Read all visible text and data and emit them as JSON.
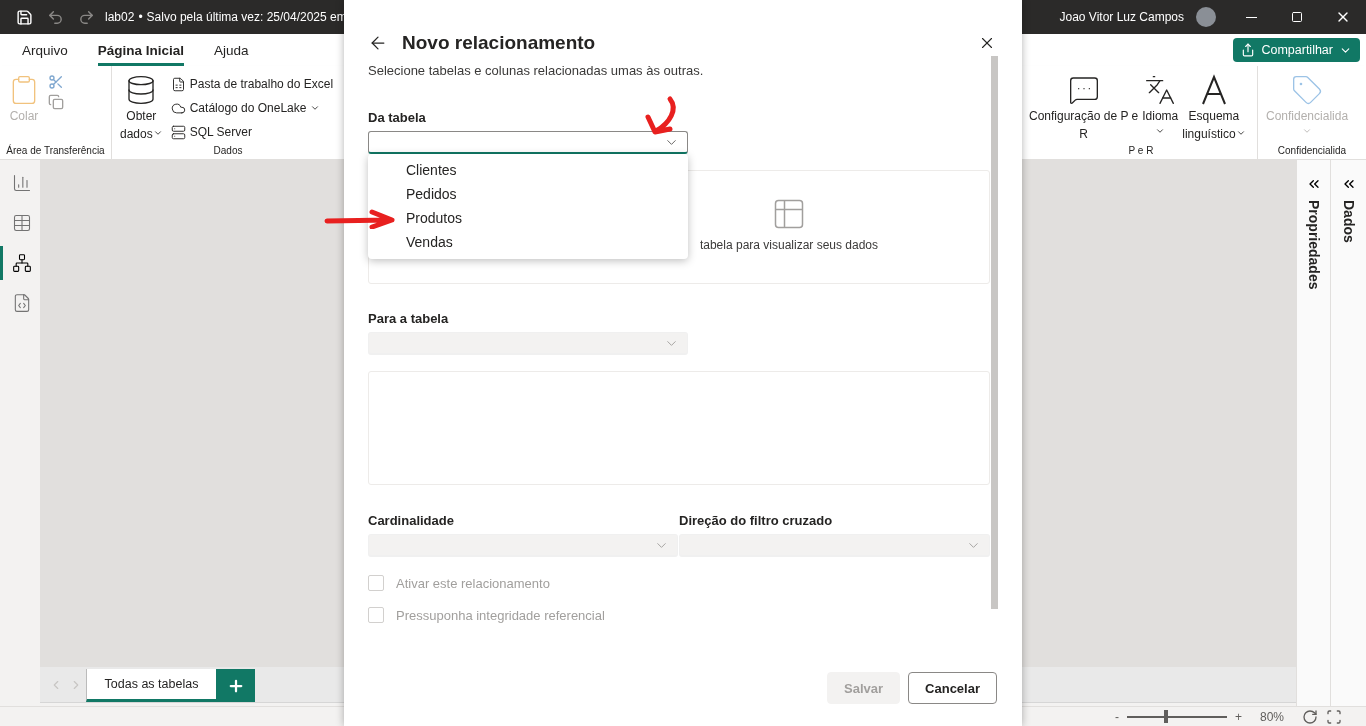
{
  "title_bar": {
    "file": "lab02",
    "separator": "•",
    "status": "Salvo pela última vez: 25/04/2025 em",
    "user": "Joao Vitor Luz Campos"
  },
  "ribbon_tabs": [
    {
      "label": "Arquivo",
      "selected": false
    },
    {
      "label": "Página Inicial",
      "selected": true
    },
    {
      "label": "Ajuda",
      "selected": false
    }
  ],
  "share_button": "Compartilhar",
  "clipboard_group": {
    "paste": "Colar",
    "label": "Área de Transferência"
  },
  "data_group": {
    "get_data": [
      "Obter",
      "dados"
    ],
    "sources": [
      {
        "kind": "excel",
        "label": "Pasta de trabalho do Excel",
        "menu": false
      },
      {
        "kind": "onelake",
        "label": "Catálogo do OneLake",
        "menu": true
      },
      {
        "kind": "sql",
        "label": "SQL Server",
        "menu": false
      }
    ],
    "label": "Dados"
  },
  "qa_group": {
    "items": [
      {
        "kind": "qa",
        "lines": [
          "Configuração de P e",
          "R"
        ],
        "menu": false
      },
      {
        "kind": "language",
        "lines": [
          "Idioma"
        ],
        "menu": true
      },
      {
        "kind": "schema",
        "lines": [
          "Esquema",
          "linguístico"
        ],
        "menu": true
      }
    ],
    "label": "P e R"
  },
  "sensitivity_group": {
    "item": "Confidencialida",
    "label": "Confidencialida"
  },
  "nav": [
    {
      "kind": "report",
      "selected": false
    },
    {
      "kind": "table",
      "selected": false
    },
    {
      "kind": "model",
      "selected": true
    },
    {
      "kind": "dax",
      "selected": false
    }
  ],
  "side_panes": [
    "Propriedades",
    "Dados"
  ],
  "page_tabs": [
    {
      "label": "Todas as tabelas",
      "selected": true
    }
  ],
  "status_bar": {
    "zoom_out": "-",
    "zoom_in": "+",
    "zoom": {
      "level": 0.39,
      "reading": "80%"
    }
  },
  "dialog": {
    "title": "Novo relacionamento",
    "subtitle": "Selecione tabelas e colunas relacionadas umas às outras.",
    "from_label": "Da tabela",
    "options": [
      {
        "label": "Clientes",
        "selected": false
      },
      {
        "label": "Pedidos",
        "selected": false
      },
      {
        "label": "Produtos",
        "selected": false
      },
      {
        "label": "Vendas",
        "selected": false
      }
    ],
    "preview_text": "tabela para visualizar seus dados",
    "to_label": "Para a tabela",
    "cardinality_label": "Cardinalidade",
    "filter_label": "Direção do filtro cruzado",
    "checks": [
      {
        "label": "Ativar este relacionamento",
        "checked": false,
        "disabled": true
      },
      {
        "label": "Pressuponha integridade referencial",
        "checked": false,
        "disabled": true
      }
    ],
    "buttons": [
      {
        "kind": "primary",
        "label": "Salvar",
        "disabled": true
      },
      {
        "kind": "secondary",
        "label": "Cancelar",
        "disabled": false
      }
    ]
  }
}
